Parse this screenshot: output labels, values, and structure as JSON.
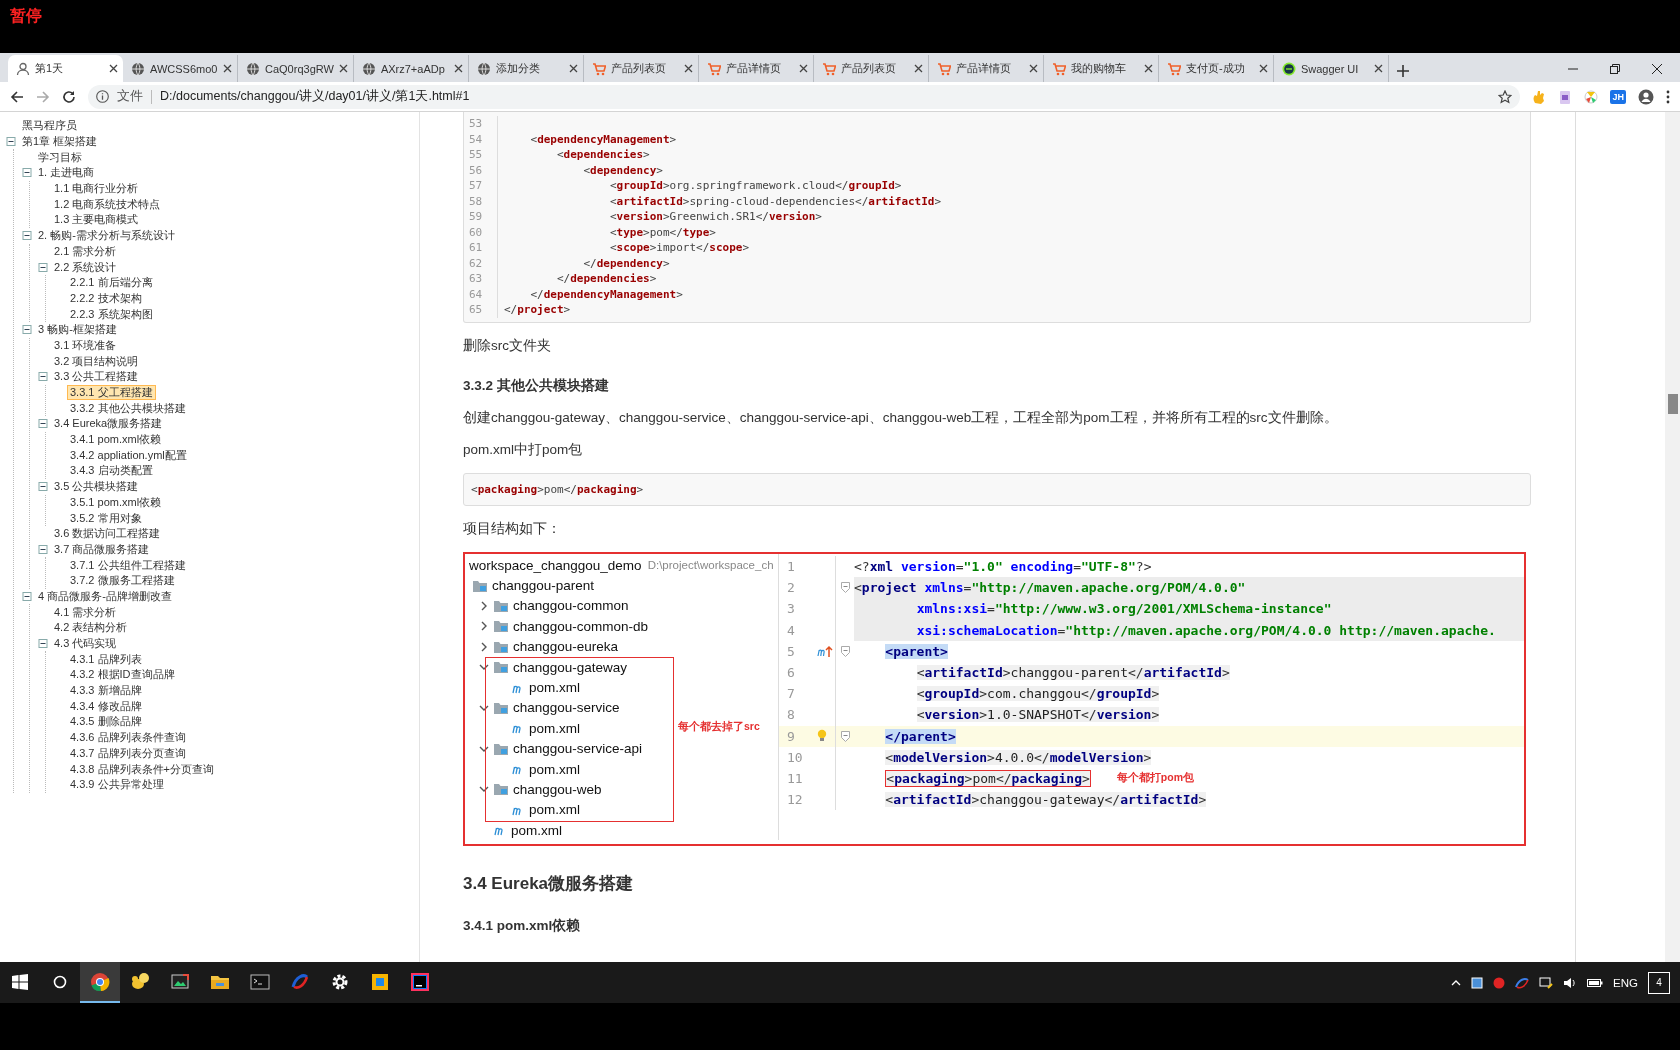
{
  "recorder_label": "暂停",
  "browser": {
    "tabs": [
      {
        "title": "第1天",
        "kind": "user",
        "selected": true
      },
      {
        "title": "AWCSS6mo0",
        "kind": "globe",
        "selected": false
      },
      {
        "title": "CaQ0rq3gRW",
        "kind": "globe",
        "selected": false
      },
      {
        "title": "AXrz7+aADp",
        "kind": "globe",
        "selected": false
      },
      {
        "title": "添加分类",
        "kind": "globe",
        "selected": false
      },
      {
        "title": "产品列表页",
        "kind": "cart",
        "selected": false
      },
      {
        "title": "产品详情页",
        "kind": "cart",
        "selected": false
      },
      {
        "title": "产品列表页",
        "kind": "cart",
        "selected": false
      },
      {
        "title": "产品详情页",
        "kind": "cart",
        "selected": false
      },
      {
        "title": "我的购物车",
        "kind": "cart",
        "selected": false
      },
      {
        "title": "支付页-成功",
        "kind": "cart",
        "selected": false
      },
      {
        "title": "Swagger UI",
        "kind": "circle",
        "selected": false
      }
    ],
    "address": {
      "scheme_label": "文件",
      "url": "D:/documents/changgou/讲义/day01/讲义/第1天.html#1"
    },
    "extensions": [
      {
        "kind": "hand"
      },
      {
        "kind": "doc"
      },
      {
        "kind": "wheel"
      },
      {
        "kind": "letters",
        "text": "JH"
      }
    ]
  },
  "sidebar": {
    "tree": [
      {
        "label": "黑马程序员",
        "selected": false
      },
      {
        "label": "第1章 框架搭建",
        "selected": false,
        "expanded": true,
        "children": [
          {
            "label": "学习目标",
            "selected": false
          },
          {
            "label": "1. 走进电商",
            "selected": false,
            "expanded": true,
            "children": [
              {
                "label": "1.1 电商行业分析",
                "selected": false
              },
              {
                "label": "1.2 电商系统技术特点",
                "selected": false
              },
              {
                "label": "1.3 主要电商模式",
                "selected": false
              }
            ]
          },
          {
            "label": "2. 畅购-需求分析与系统设计",
            "selected": false,
            "expanded": true,
            "children": [
              {
                "label": "2.1 需求分析",
                "selected": false
              },
              {
                "label": "2.2 系统设计",
                "selected": false,
                "expanded": true,
                "children": [
                  {
                    "label": "2.2.1 前后端分离",
                    "selected": false
                  },
                  {
                    "label": "2.2.2 技术架构",
                    "selected": false
                  },
                  {
                    "label": "2.2.3 系统架构图",
                    "selected": false
                  }
                ]
              }
            ]
          },
          {
            "label": "3 畅购-框架搭建",
            "selected": false,
            "expanded": true,
            "children": [
              {
                "label": "3.1 环境准备",
                "selected": false
              },
              {
                "label": "3.2 项目结构说明",
                "selected": false
              },
              {
                "label": "3.3 公共工程搭建",
                "selected": false,
                "expanded": true,
                "children": [
                  {
                    "label": "3.3.1 父工程搭建",
                    "selected": true
                  },
                  {
                    "label": "3.3.2 其他公共模块搭建",
                    "selected": false
                  }
                ]
              },
              {
                "label": "3.4 Eureka微服务搭建",
                "selected": false,
                "expanded": true,
                "children": [
                  {
                    "label": "3.4.1 pom.xml依赖",
                    "selected": false
                  },
                  {
                    "label": "3.4.2 appliation.yml配置",
                    "selected": false
                  },
                  {
                    "label": "3.4.3 启动类配置",
                    "selected": false
                  }
                ]
              },
              {
                "label": "3.5 公共模块搭建",
                "selected": false,
                "expanded": true,
                "children": [
                  {
                    "label": "3.5.1 pom.xml依赖",
                    "selected": false
                  },
                  {
                    "label": "3.5.2 常用对象",
                    "selected": false
                  }
                ]
              },
              {
                "label": "3.6 数据访问工程搭建",
                "selected": false
              },
              {
                "label": "3.7 商品微服务搭建",
                "selected": false,
                "expanded": true,
                "children": [
                  {
                    "label": "3.7.1 公共组件工程搭建",
                    "selected": false
                  },
                  {
                    "label": "3.7.2 微服务工程搭建",
                    "selected": false
                  }
                ]
              }
            ]
          },
          {
            "label": "4 商品微服务-品牌增删改查",
            "selected": false,
            "expanded": true,
            "children": [
              {
                "label": "4.1 需求分析",
                "selected": false
              },
              {
                "label": "4.2 表结构分析",
                "selected": false
              },
              {
                "label": "4.3 代码实现",
                "selected": false,
                "expanded": true,
                "children": [
                  {
                    "label": "4.3.1 品牌列表",
                    "selected": false
                  },
                  {
                    "label": "4.3.2 根据ID查询品牌",
                    "selected": false
                  },
                  {
                    "label": "4.3.3 新增品牌",
                    "selected": false
                  },
                  {
                    "label": "4.3.4 修改品牌",
                    "selected": false
                  },
                  {
                    "label": "4.3.5 删除品牌",
                    "selected": false
                  },
                  {
                    "label": "4.3.6 品牌列表条件查询",
                    "selected": false
                  },
                  {
                    "label": "4.3.7 品牌列表分页查询",
                    "selected": false
                  },
                  {
                    "label": "4.3.8 品牌列表条件+分页查询",
                    "selected": false
                  },
                  {
                    "label": "4.3.9 公共异常处理",
                    "selected": false
                  }
                ]
              }
            ]
          }
        ]
      }
    ]
  },
  "content": [
    {
      "kind": "code",
      "lines": [
        {
          "number": "53"
        },
        {
          "number": "54",
          "text": "    <**dependencyManagement**>"
        },
        {
          "number": "55",
          "text": "        <**dependencies**>"
        },
        {
          "number": "56",
          "text": "            <**dependency**>"
        },
        {
          "number": "57",
          "text": "                <**groupId**>org.springframework.cloud</**groupId**>"
        },
        {
          "number": "58",
          "text": "                <**artifactId**>spring-cloud-dependencies</**artifactId**>"
        },
        {
          "number": "59",
          "text": "                <**version**>Greenwich.SR1</**version**>"
        },
        {
          "number": "60",
          "text": "                <**type**>pom</**type**>"
        },
        {
          "number": "61",
          "text": "                <**scope**>import</**scope**>"
        },
        {
          "number": "62",
          "text": "            </**dependency**>"
        },
        {
          "number": "63",
          "text": "        </**dependencies**>"
        },
        {
          "number": "64",
          "text": "    </**dependencyManagement**>"
        },
        {
          "number": "65",
          "text": "</**project**>"
        }
      ]
    },
    {
      "kind": "para",
      "text": "删除src文件夹"
    },
    {
      "kind": "h4",
      "text": "3.3.2 其他公共模块搭建"
    },
    {
      "kind": "para",
      "text": "创建changgou-gateway、changgou-service、changgou-service-api、changgou-web工程，工程全部为pom工程，并将所有工程的src文件删除。"
    },
    {
      "kind": "para",
      "text": "pom.xml中打pom包"
    },
    {
      "kind": "code",
      "lines": [
        {
          "text": "<**packaging**>pom</**packaging**>"
        }
      ]
    },
    {
      "kind": "para",
      "text": "项目结构如下："
    },
    {
      "kind": "ide",
      "project": {
        "root": "workspace_changgou_demo",
        "root_path": "D:\\project\\workspace_ch",
        "note": "每个都去掉了src",
        "items": [
          {
            "label": "changgou-parent",
            "kind": "module",
            "children": [
              {
                "label": "changgou-common",
                "kind": "module",
                "expanded": false
              },
              {
                "label": "changgou-common-db",
                "kind": "module",
                "expanded": false
              },
              {
                "label": "changgou-eureka",
                "kind": "module",
                "expanded": false
              },
              {
                "label": "changgou-gateway",
                "kind": "module",
                "expanded": true,
                "boxed": true,
                "children": [
                  {
                    "label": "pom.xml",
                    "kind": "pom"
                  }
                ]
              },
              {
                "label": "changgou-service",
                "kind": "module",
                "expanded": true,
                "boxed": true,
                "children": [
                  {
                    "label": "pom.xml",
                    "kind": "pom"
                  }
                ]
              },
              {
                "label": "changgou-service-api",
                "kind": "module",
                "expanded": true,
                "boxed": true,
                "children": [
                  {
                    "label": "pom.xml",
                    "kind": "pom"
                  }
                ]
              },
              {
                "label": "changgou-web",
                "kind": "module",
                "expanded": true,
                "boxed": true,
                "children": [
                  {
                    "label": "pom.xml",
                    "kind": "pom"
                  }
                ]
              },
              {
                "label": "pom.xml",
                "kind": "pom"
              }
            ]
          }
        ]
      },
      "editor": {
        "lines": [
          {
            "number": "1",
            "segments": [
              {
                "kind": "punct",
                "text": "<?"
              },
              {
                "kind": "tag",
                "text": "xml"
              },
              {
                "kind": "attr",
                "text": " version"
              },
              {
                "kind": "punct",
                "text": "="
              },
              {
                "kind": "str",
                "text": "\"1.0\""
              },
              {
                "kind": "attr",
                "text": " encoding"
              },
              {
                "kind": "punct",
                "text": "="
              },
              {
                "kind": "str",
                "text": "\"UTF-8\""
              },
              {
                "kind": "punct",
                "text": "?>"
              }
            ]
          },
          {
            "number": "2",
            "block": true,
            "fold": true,
            "segments": [
              {
                "kind": "punct",
                "text": "<"
              },
              {
                "kind": "tag",
                "text": "project"
              },
              {
                "kind": "attr",
                "text": " xmlns"
              },
              {
                "kind": "punct",
                "text": "="
              },
              {
                "kind": "str",
                "text": "\"http://maven.apache.org/POM/4.0.0\""
              }
            ]
          },
          {
            "number": "3",
            "block": true,
            "segments": [
              {
                "kind": "attr",
                "text": "        xmlns:xsi"
              },
              {
                "kind": "punct",
                "text": "="
              },
              {
                "kind": "str",
                "text": "\"http://www.w3.org/2001/XMLSchema-instance\""
              }
            ]
          },
          {
            "number": "4",
            "block": true,
            "segments": [
              {
                "kind": "attr",
                "text": "        xsi:schemaLocation"
              },
              {
                "kind": "punct",
                "text": "="
              },
              {
                "kind": "str",
                "text": "\"http://maven.apache.org/POM/4.0.0 http://maven.apache."
              }
            ]
          },
          {
            "number": "5",
            "fold": true,
            "override_marker": true,
            "segments": [
              {
                "kind": "match",
                "text": "    <parent>"
              }
            ]
          },
          {
            "number": "6",
            "shaded": true,
            "segments": [
              {
                "kind": "punct",
                "text": "        <"
              },
              {
                "kind": "tag",
                "text": "artifactId"
              },
              {
                "kind": "punct",
                "text": ">"
              },
              {
                "kind": "text",
                "text": "changgou-parent"
              },
              {
                "kind": "punct",
                "text": "</"
              },
              {
                "kind": "tag",
                "text": "artifactId"
              },
              {
                "kind": "punct",
                "text": ">"
              }
            ]
          },
          {
            "number": "7",
            "shaded": true,
            "segments": [
              {
                "kind": "punct",
                "text": "        <"
              },
              {
                "kind": "tag",
                "text": "groupId"
              },
              {
                "kind": "punct",
                "text": ">"
              },
              {
                "kind": "text",
                "text": "com.changgou"
              },
              {
                "kind": "punct",
                "text": "</"
              },
              {
                "kind": "tag",
                "text": "groupId"
              },
              {
                "kind": "punct",
                "text": ">"
              }
            ]
          },
          {
            "number": "8",
            "shaded": true,
            "segments": [
              {
                "kind": "punct",
                "text": "        <"
              },
              {
                "kind": "tag",
                "text": "version"
              },
              {
                "kind": "punct",
                "text": ">"
              },
              {
                "kind": "text",
                "text": "1.0-SNAPSHOT"
              },
              {
                "kind": "punct",
                "text": "</"
              },
              {
                "kind": "tag",
                "text": "version"
              },
              {
                "kind": "punct",
                "text": ">"
              }
            ]
          },
          {
            "number": "9",
            "current": true,
            "fold": true,
            "bulb": true,
            "segments": [
              {
                "kind": "match",
                "text": "    </parent>"
              }
            ]
          },
          {
            "number": "10",
            "shaded": true,
            "segments": [
              {
                "kind": "punct",
                "text": "    <"
              },
              {
                "kind": "tag",
                "text": "modelVersion"
              },
              {
                "kind": "punct",
                "text": ">"
              },
              {
                "kind": "text",
                "text": "4.0.0"
              },
              {
                "kind": "punct",
                "text": "</"
              },
              {
                "kind": "tag",
                "text": "modelVersion"
              },
              {
                "kind": "punct",
                "text": ">"
              }
            ]
          },
          {
            "number": "11",
            "shaded": true,
            "boxed": true,
            "note": "每个都打pom包",
            "segments": [
              {
                "kind": "punct",
                "text": "    <"
              },
              {
                "kind": "tag",
                "text": "packaging"
              },
              {
                "kind": "punct",
                "text": ">"
              },
              {
                "kind": "text",
                "text": "pom"
              },
              {
                "kind": "punct",
                "text": "</"
              },
              {
                "kind": "tag",
                "text": "packaging"
              },
              {
                "kind": "punct",
                "text": ">"
              }
            ]
          },
          {
            "number": "12",
            "shaded": true,
            "segments": [
              {
                "kind": "punct",
                "text": "    <"
              },
              {
                "kind": "tag",
                "text": "artifactId"
              },
              {
                "kind": "punct",
                "text": ">"
              },
              {
                "kind": "text",
                "text": "changgou-gateway"
              },
              {
                "kind": "punct",
                "text": "</"
              },
              {
                "kind": "tag",
                "text": "artifactId"
              },
              {
                "kind": "punct",
                "text": ">"
              }
            ]
          }
        ]
      }
    },
    {
      "kind": "h3",
      "text": "3.4 Eureka微服务搭建"
    },
    {
      "kind": "h4",
      "text": "3.4.1 pom.xml依赖"
    }
  ],
  "taskbar": {
    "apps": [
      {
        "kind": "chrome",
        "active": true
      },
      {
        "kind": "squirrel",
        "active": false
      },
      {
        "kind": "screenshot",
        "active": false
      },
      {
        "kind": "folder",
        "active": false
      },
      {
        "kind": "terminal",
        "active": false
      },
      {
        "kind": "swirl",
        "active": false
      },
      {
        "kind": "gear",
        "active": false
      },
      {
        "kind": "box",
        "active": false
      },
      {
        "kind": "ide",
        "active": false
      }
    ],
    "language": "ENG",
    "notifications": "4"
  }
}
